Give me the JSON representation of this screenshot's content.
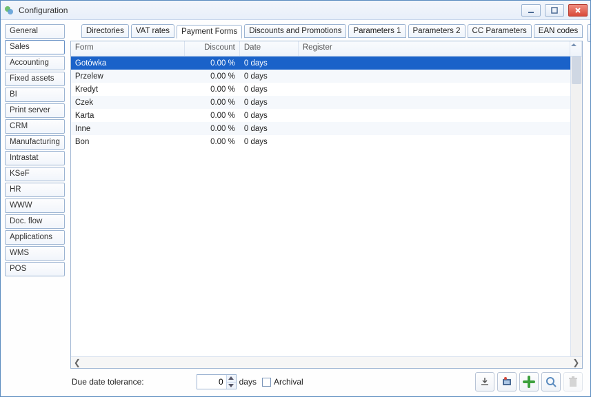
{
  "window": {
    "title": "Configuration"
  },
  "sidebar": {
    "items": [
      {
        "label": "General"
      },
      {
        "label": "Sales"
      },
      {
        "label": "Accounting"
      },
      {
        "label": "Fixed assets"
      },
      {
        "label": "BI"
      },
      {
        "label": "Print server"
      },
      {
        "label": "CRM"
      },
      {
        "label": "Manufacturing"
      },
      {
        "label": "Intrastat"
      },
      {
        "label": "KSeF"
      },
      {
        "label": "HR"
      },
      {
        "label": "WWW"
      },
      {
        "label": "Doc. flow"
      },
      {
        "label": "Applications"
      },
      {
        "label": "WMS"
      },
      {
        "label": "POS"
      }
    ],
    "active_index": 1
  },
  "tabs": {
    "items": [
      {
        "label": "Directories"
      },
      {
        "label": "VAT rates"
      },
      {
        "label": "Payment Forms"
      },
      {
        "label": "Discounts and Promotions"
      },
      {
        "label": "Parameters 1"
      },
      {
        "label": "Parameters 2"
      },
      {
        "label": "CC Parameters"
      },
      {
        "label": "EAN codes"
      }
    ],
    "active_index": 2
  },
  "grid": {
    "columns": {
      "form": "Form",
      "discount": "Discount",
      "date": "Date",
      "register": "Register"
    },
    "rows": [
      {
        "form": "Gotówka",
        "discount": "0.00 %",
        "date": "0 days",
        "register": ""
      },
      {
        "form": "Przelew",
        "discount": "0.00 %",
        "date": "0 days",
        "register": ""
      },
      {
        "form": "Kredyt",
        "discount": "0.00 %",
        "date": "0 days",
        "register": ""
      },
      {
        "form": "Czek",
        "discount": "0.00 %",
        "date": "0 days",
        "register": ""
      },
      {
        "form": "Karta",
        "discount": "0.00 %",
        "date": "0 days",
        "register": ""
      },
      {
        "form": "Inne",
        "discount": "0.00 %",
        "date": "0 days",
        "register": ""
      },
      {
        "form": "Bon",
        "discount": "0.00 %",
        "date": "0 days",
        "register": ""
      }
    ],
    "selected_index": 0
  },
  "footer": {
    "due_label": "Due date tolerance:",
    "due_value": "0",
    "due_unit": "days",
    "archival_label": "Archival",
    "archival_checked": false
  },
  "icons": {
    "save": "save-icon",
    "cancel": "cancel-icon"
  }
}
